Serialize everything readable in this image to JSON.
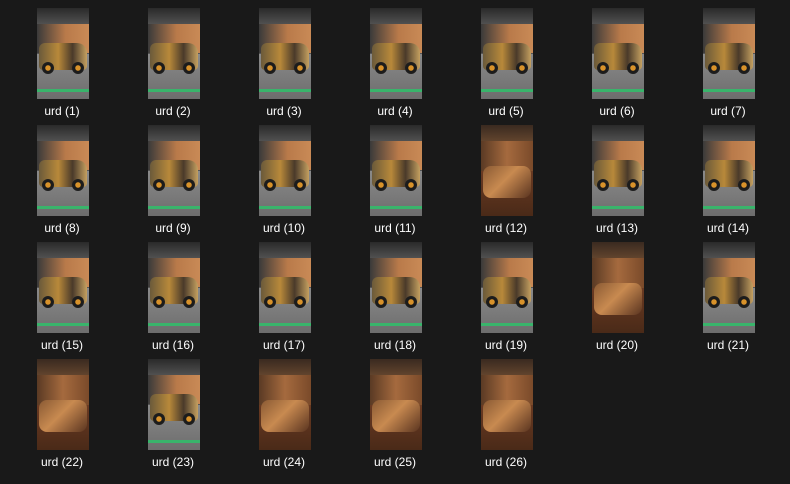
{
  "files": [
    {
      "name": "urd (1)",
      "kind": "exterior"
    },
    {
      "name": "urd (2)",
      "kind": "exterior"
    },
    {
      "name": "urd (3)",
      "kind": "exterior"
    },
    {
      "name": "urd (4)",
      "kind": "exterior"
    },
    {
      "name": "urd (5)",
      "kind": "exterior"
    },
    {
      "name": "urd (6)",
      "kind": "exterior"
    },
    {
      "name": "urd (7)",
      "kind": "exterior"
    },
    {
      "name": "urd (8)",
      "kind": "exterior"
    },
    {
      "name": "urd (9)",
      "kind": "exterior"
    },
    {
      "name": "urd (10)",
      "kind": "exterior"
    },
    {
      "name": "urd (11)",
      "kind": "exterior"
    },
    {
      "name": "urd (12)",
      "kind": "interior"
    },
    {
      "name": "urd (13)",
      "kind": "exterior"
    },
    {
      "name": "urd (14)",
      "kind": "exterior"
    },
    {
      "name": "urd (15)",
      "kind": "exterior"
    },
    {
      "name": "urd (16)",
      "kind": "exterior"
    },
    {
      "name": "urd (17)",
      "kind": "exterior"
    },
    {
      "name": "urd (18)",
      "kind": "exterior"
    },
    {
      "name": "urd (19)",
      "kind": "exterior"
    },
    {
      "name": "urd (20)",
      "kind": "interior"
    },
    {
      "name": "urd (21)",
      "kind": "exterior"
    },
    {
      "name": "urd (22)",
      "kind": "interior"
    },
    {
      "name": "urd (23)",
      "kind": "exterior"
    },
    {
      "name": "urd (24)",
      "kind": "interior"
    },
    {
      "name": "urd (25)",
      "kind": "interior"
    },
    {
      "name": "urd (26)",
      "kind": "interior"
    }
  ]
}
